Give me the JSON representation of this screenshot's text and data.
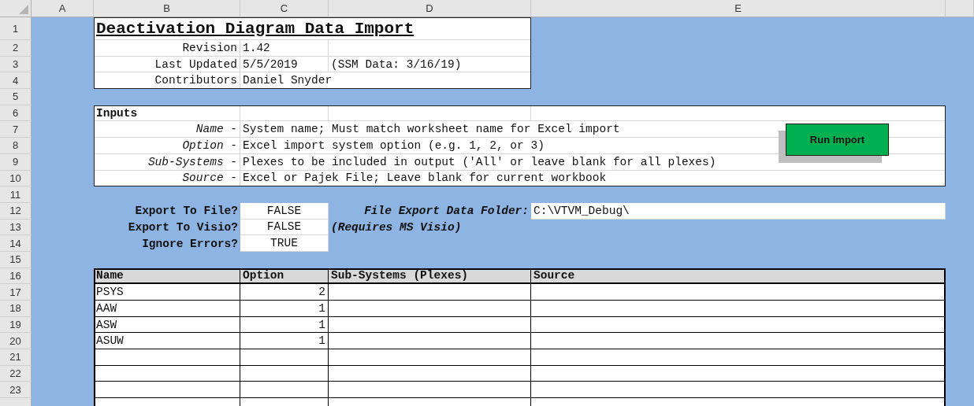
{
  "column_headers": [
    "A",
    "B",
    "C",
    "D",
    "E"
  ],
  "row_headers": [
    "1",
    "2",
    "3",
    "4",
    "5",
    "6",
    "7",
    "8",
    "9",
    "10",
    "11",
    "12",
    "13",
    "14",
    "15",
    "16",
    "17",
    "18",
    "19",
    "20",
    "21",
    "22",
    "23"
  ],
  "header": {
    "title": "Deactivation Diagram Data Import",
    "fields": [
      {
        "label": "Revision",
        "value": "1.42"
      },
      {
        "label": "Last Updated",
        "value": "5/5/2019",
        "note": "(SSM Data: 3/16/19)"
      },
      {
        "label": "Contributors",
        "value": "Daniel Snyder"
      }
    ]
  },
  "inputs": {
    "title": "Inputs",
    "items": [
      {
        "label": "*Name* -",
        "description": "System name; Must match worksheet name for Excel import"
      },
      {
        "label": "*Option* -",
        "description": "Excel import system option (e.g. 1, 2, or 3)"
      },
      {
        "label": "*Sub-Systems* -",
        "description": "Plexes to be included in output ('All' or leave blank for all plexes)"
      },
      {
        "label": "*Source* -",
        "description": "Excel or Pajek File; Leave blank for current workbook"
      }
    ]
  },
  "run_button": "Run Import",
  "settings": [
    {
      "label": "Export To File?",
      "value": "FALSE"
    },
    {
      "label": "Export To Visio?",
      "value": "FALSE"
    },
    {
      "label": "Ignore Errors?",
      "value": "TRUE"
    }
  ],
  "export_folder": {
    "label": "File Export Data Folder:",
    "value": "C:\\VTVM_Debug\\"
  },
  "visio_note": "(Requires MS Visio)",
  "table": {
    "columns": [
      "Name",
      "Option",
      "Sub-Systems (Plexes)",
      "Source"
    ],
    "rows": [
      {
        "name": "PSYS",
        "option": "2"
      },
      {
        "name": "AAW",
        "option": "1"
      },
      {
        "name": "ASW",
        "option": "1"
      },
      {
        "name": "ASUW",
        "option": "1"
      }
    ]
  }
}
